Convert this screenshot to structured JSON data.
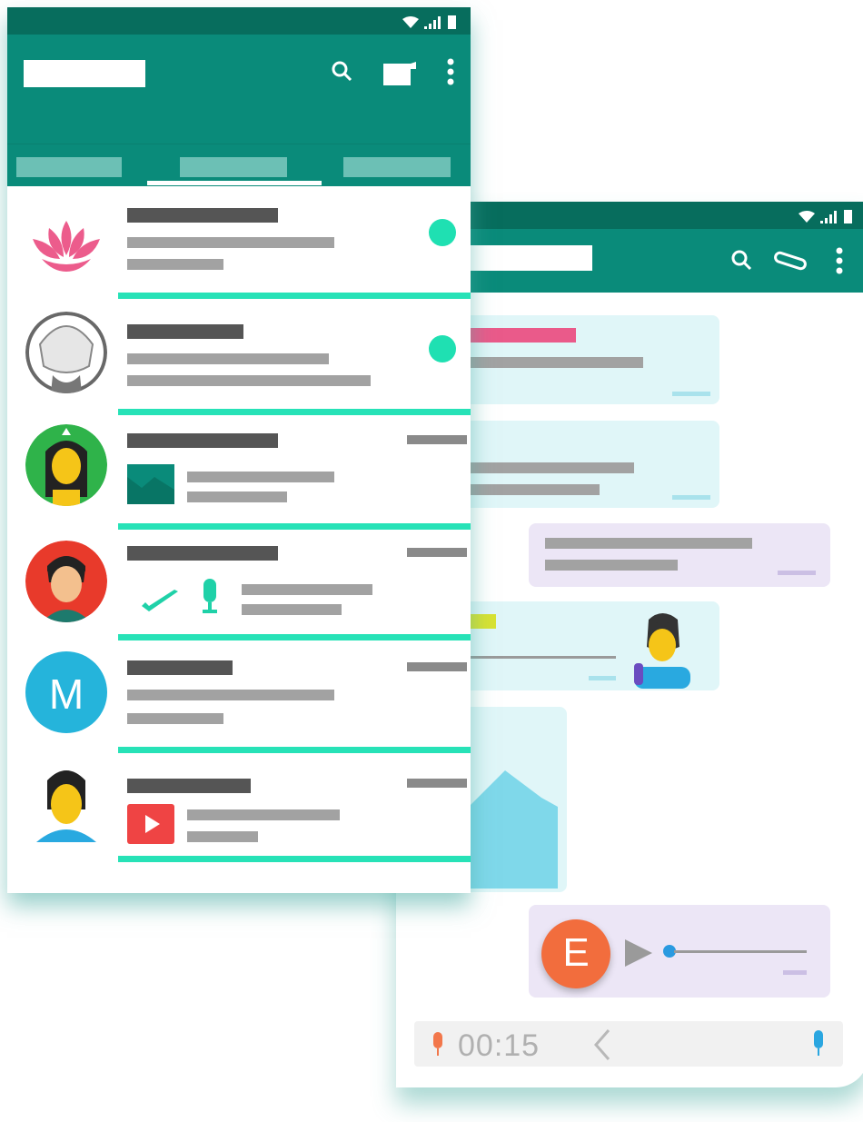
{
  "chat_detail": {
    "voice_timer": "00:15",
    "sender_avatar_letter": "E"
  },
  "chat_list": {
    "rows": [
      {
        "avatar": "lotus",
        "unread": true,
        "preview": "text"
      },
      {
        "avatar": "gray-face",
        "unread": true,
        "preview": "text"
      },
      {
        "avatar": "woman-green",
        "unread": false,
        "preview": "image"
      },
      {
        "avatar": "man-red",
        "unread": false,
        "preview": "voice"
      },
      {
        "avatar": "letter",
        "avatar_letter": "M",
        "unread": false,
        "preview": "text"
      },
      {
        "avatar": "man-blue",
        "unread": false,
        "preview": "video"
      }
    ]
  },
  "icons": {
    "front_bar": [
      "search-icon",
      "chat-icon",
      "more-vert-icon"
    ],
    "back_bar": [
      "search-icon",
      "attach-icon",
      "more-vert-icon"
    ],
    "status": [
      "wifi-icon",
      "signal-icon",
      "battery-icon"
    ],
    "input": [
      "mic-icon",
      "chevron-left-icon",
      "mic-icon"
    ]
  },
  "colors": {
    "header": "#0a8b7a",
    "status_bar": "#076d5d",
    "accent": "#27e2b7",
    "incoming_bubble": "#e0f6f8",
    "outgoing_bubble": "#ece6f6"
  }
}
